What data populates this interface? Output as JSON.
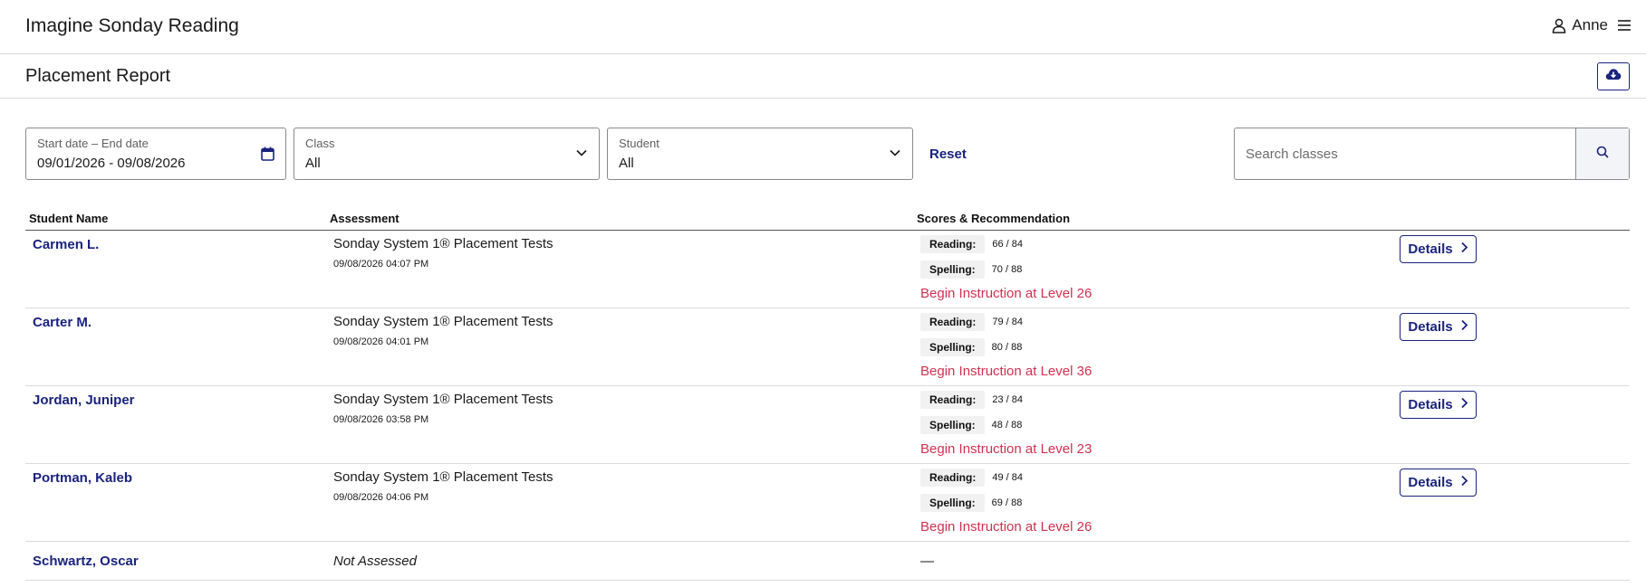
{
  "header": {
    "app_title": "Imagine Sonday Reading",
    "user_name": "Anne",
    "user_icon": "user-icon",
    "menu_icon": "hamburger-menu-icon"
  },
  "page": {
    "title": "Placement Report",
    "download_icon": "cloud-download-icon"
  },
  "filters": {
    "date": {
      "label": "Start date – End date",
      "value": "09/01/2026 - 09/08/2026",
      "icon": "calendar-icon"
    },
    "class": {
      "label": "Class",
      "value": "All"
    },
    "student": {
      "label": "Student",
      "value": "All"
    },
    "reset_label": "Reset",
    "search": {
      "placeholder": "Search classes",
      "icon": "search-icon"
    }
  },
  "table": {
    "columns": [
      "Student Name",
      "Assessment",
      "Scores & Recommendation"
    ],
    "score_labels": {
      "reading": "Reading:",
      "spelling": "Spelling:"
    },
    "details_label": "Details",
    "rows": [
      {
        "name": "Carmen L.",
        "assessment": "Sonday System 1® Placement Tests",
        "date": "09/08/2026 04:07 PM",
        "reading": "66 / 84",
        "spelling": "70 / 88",
        "recommendation": "Begin Instruction at Level 26"
      },
      {
        "name": "Carter M.",
        "assessment": "Sonday System 1® Placement Tests",
        "date": "09/08/2026 04:01 PM",
        "reading": "79 / 84",
        "spelling": "80 / 88",
        "recommendation": "Begin Instruction at Level 36"
      },
      {
        "name": "Jordan, Juniper",
        "assessment": "Sonday System 1® Placement Tests",
        "date": "09/08/2026 03:58 PM",
        "reading": "23 / 84",
        "spelling": "48 / 88",
        "recommendation": "Begin Instruction at Level 23"
      },
      {
        "name": "Portman, Kaleb",
        "assessment": "Sonday System 1® Placement Tests",
        "date": "09/08/2026 04:06 PM",
        "reading": "49 / 84",
        "spelling": "69 / 88",
        "recommendation": "Begin Instruction at Level 26"
      },
      {
        "name": "Schwartz, Oscar",
        "assessment": "Not Assessed",
        "scores": "—"
      }
    ]
  },
  "colors": {
    "brand": "#1a237e",
    "recommendation": "#d32f4f"
  }
}
